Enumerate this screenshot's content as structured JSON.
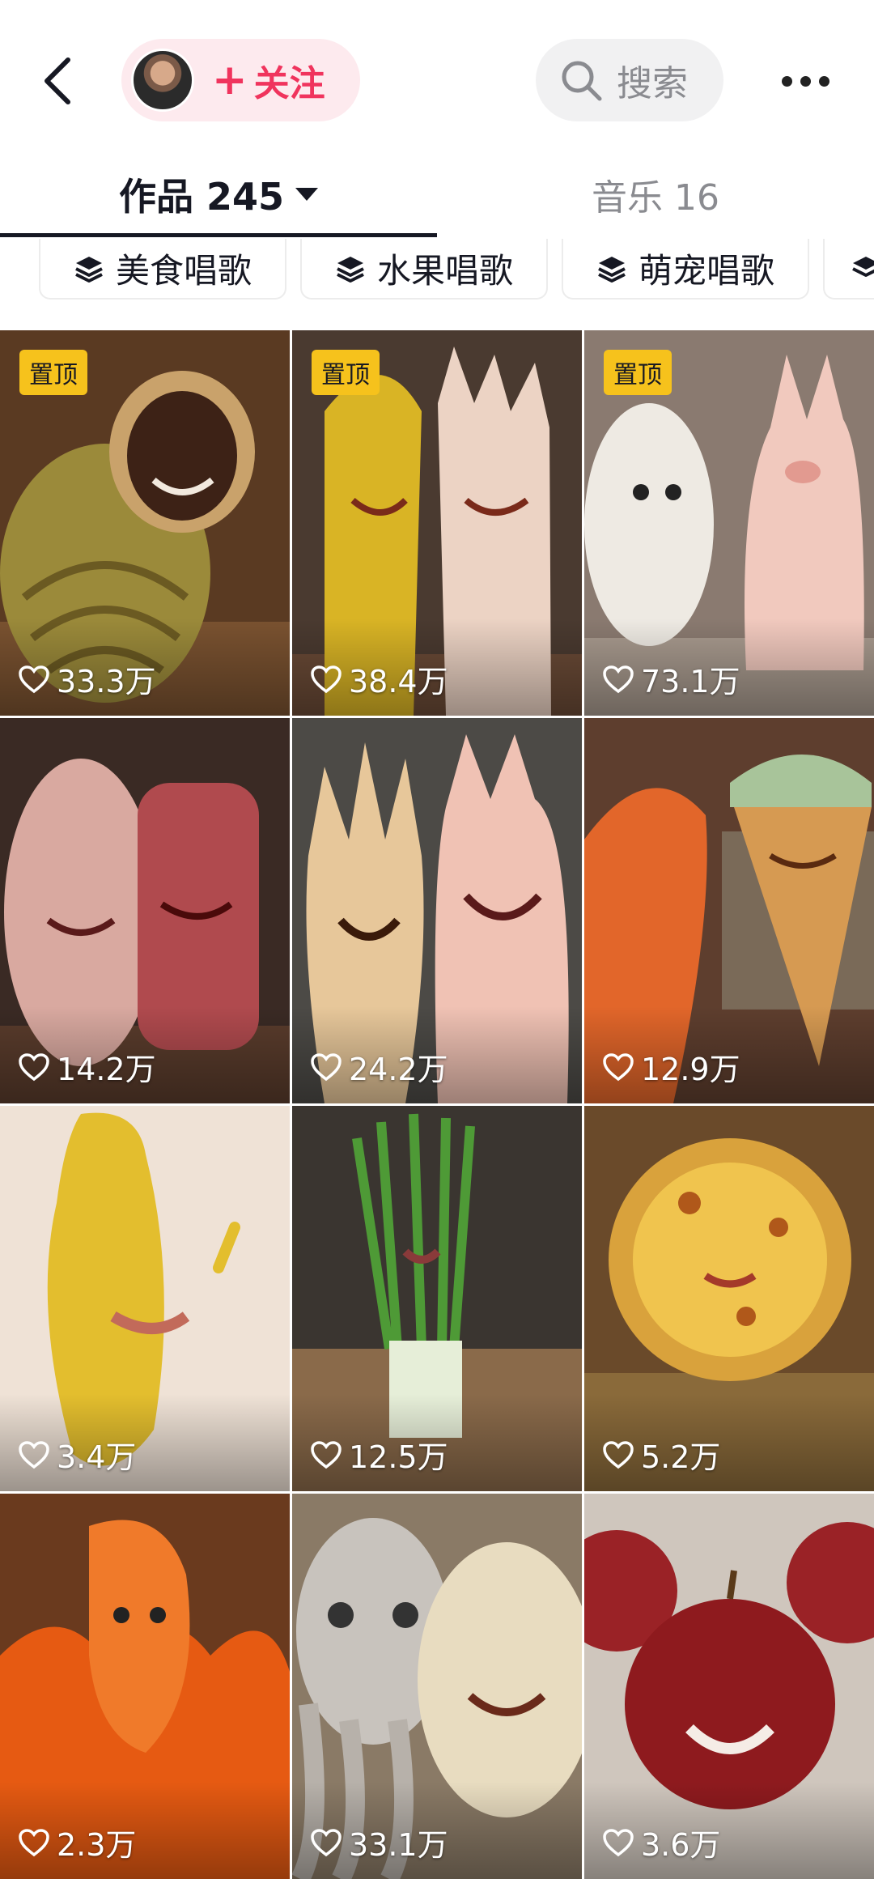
{
  "header": {
    "follow_plus": "+",
    "follow_label": "关注",
    "search_label": "搜索"
  },
  "tabs": [
    {
      "label": "作品 245"
    },
    {
      "label": "音乐 16"
    }
  ],
  "collections": [
    {
      "label": "美食唱歌"
    },
    {
      "label": "水果唱歌"
    },
    {
      "label": "萌宠唱歌"
    }
  ],
  "videos": [
    {
      "pinned": "置顶",
      "likes": "33.3万"
    },
    {
      "pinned": "置顶",
      "likes": "38.4万"
    },
    {
      "pinned": "置顶",
      "likes": "73.1万"
    },
    {
      "likes": "14.2万"
    },
    {
      "likes": "24.2万"
    },
    {
      "likes": "12.9万"
    },
    {
      "likes": "3.4万"
    },
    {
      "likes": "12.5万"
    },
    {
      "likes": "5.2万"
    },
    {
      "likes": "2.3万"
    },
    {
      "likes": "33.1万"
    },
    {
      "likes": "3.6万"
    }
  ],
  "colors": {
    "accent": "#f0345d",
    "pin_badge": "#f6c21c",
    "text_primary": "#161823",
    "text_secondary": "#8a8b90"
  }
}
